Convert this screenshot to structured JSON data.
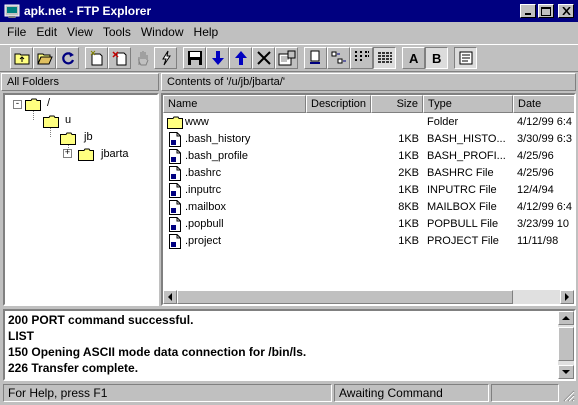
{
  "window": {
    "title": "apk.net - FTP Explorer"
  },
  "menu": [
    "File",
    "Edit",
    "View",
    "Tools",
    "Window",
    "Help"
  ],
  "panes": {
    "left_header": "All Folders",
    "right_header": "Contents of '/u/jb/jbarta/'"
  },
  "tree": [
    {
      "label": "/",
      "expander": "-"
    },
    {
      "label": "u"
    },
    {
      "label": "jb"
    },
    {
      "label": "jbarta",
      "expander": "+"
    }
  ],
  "columns": [
    "Name",
    "Description",
    "Size",
    "Type",
    "Date"
  ],
  "files": [
    {
      "name": "www",
      "desc": "",
      "size": "",
      "type": "Folder",
      "date": "4/12/99 6:4",
      "kind": "folder"
    },
    {
      "name": ".bash_history",
      "desc": "",
      "size": "1KB",
      "type": "BASH_HISTO...",
      "date": "3/30/99 6:3",
      "kind": "file"
    },
    {
      "name": ".bash_profile",
      "desc": "",
      "size": "1KB",
      "type": "BASH_PROFI...",
      "date": "4/25/96",
      "kind": "file"
    },
    {
      "name": ".bashrc",
      "desc": "",
      "size": "2KB",
      "type": "BASHRC File",
      "date": "4/25/96",
      "kind": "file"
    },
    {
      "name": ".inputrc",
      "desc": "",
      "size": "1KB",
      "type": "INPUTRC File",
      "date": "12/4/94",
      "kind": "file"
    },
    {
      "name": ".mailbox",
      "desc": "",
      "size": "8KB",
      "type": "MAILBOX File",
      "date": "4/12/99 6:4",
      "kind": "file"
    },
    {
      "name": ".popbull",
      "desc": "",
      "size": "1KB",
      "type": "POPBULL File",
      "date": "3/23/99 10",
      "kind": "file"
    },
    {
      "name": ".project",
      "desc": "",
      "size": "1KB",
      "type": "PROJECT File",
      "date": "11/11/98",
      "kind": "file"
    }
  ],
  "log": [
    "200 PORT command successful.",
    "LIST",
    "150 Opening ASCII mode data connection for /bin/ls.",
    "226 Transfer complete."
  ],
  "status": {
    "help": "For Help, press F1",
    "state": "Awaiting Command"
  },
  "colors": {
    "titlebar": "#000080",
    "face": "#c0c0c0"
  }
}
